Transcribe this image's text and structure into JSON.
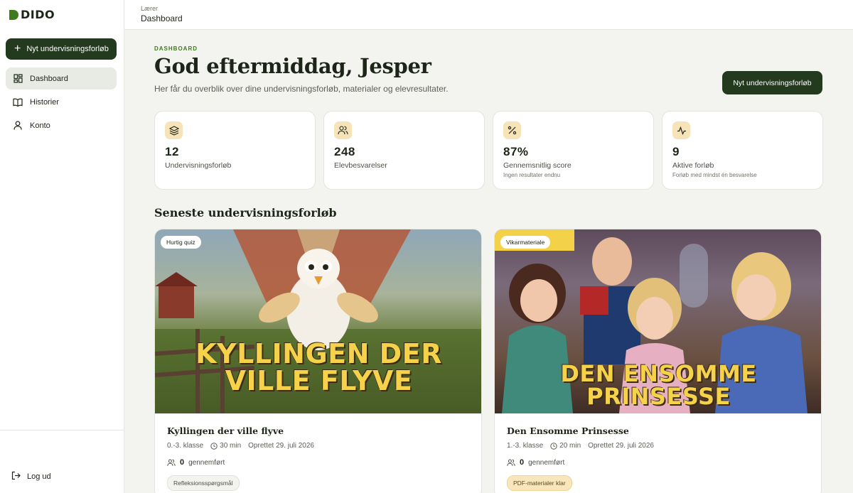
{
  "brand": {
    "name": "DIDO",
    "accent": "#3f7a1e",
    "dark": "#233a1f"
  },
  "sidebar": {
    "new_button": "Nyt undervisningsforløb",
    "items": [
      {
        "label": "Dashboard",
        "icon": "grid-icon",
        "active": true
      },
      {
        "label": "Historier",
        "icon": "book-icon",
        "active": false
      },
      {
        "label": "Konto",
        "icon": "user-icon",
        "active": false
      }
    ],
    "logout": "Log ud"
  },
  "topbar": {
    "role": "Lærer",
    "title": "Dashboard"
  },
  "header": {
    "eyebrow": "DASHBOARD",
    "greeting": "God eftermiddag, Jesper",
    "subtitle": "Her får du overblik over dine undervisningsforløb, materialer og elevresultater.",
    "cta": "Nyt undervisningsforløb"
  },
  "stats": [
    {
      "icon": "layers-icon",
      "value": "12",
      "label": "Undervisningsforløb",
      "note": ""
    },
    {
      "icon": "users-icon",
      "value": "248",
      "label": "Elevbesvarelser",
      "note": ""
    },
    {
      "icon": "percent-icon",
      "value": "87%",
      "label": "Gennemsnitlig score",
      "note": "Ingen resultater endnu"
    },
    {
      "icon": "activity-icon",
      "value": "9",
      "label": "Aktive forløb",
      "note": "Forløb med mindst én besvarelse"
    }
  ],
  "recent": {
    "title": "Seneste undervisningsforløb",
    "cards": [
      {
        "badge": "Hurtig quiz",
        "image_title_line1": "KYLLINGEN DER",
        "image_title_line2": "VILLE FLYVE",
        "title": "Kyllingen der ville flyve",
        "grade": "0.-3. klasse",
        "duration": "30 min",
        "created": "Oprettet 29. juli 2026",
        "count": "0",
        "count_label": "gennemført",
        "chip": "Refleksionsspørgsmål"
      },
      {
        "badge": "Vikarmateriale",
        "image_title_line1": "DEN ENSOMME PRINSESSE",
        "image_title_line2": "",
        "title": "Den Ensomme Prinsesse",
        "grade": "1.-3. klasse",
        "duration": "20 min",
        "created": "Oprettet 29. juli 2026",
        "count": "0",
        "count_label": "gennemført",
        "chip": "PDF-materialer klar"
      }
    ]
  }
}
